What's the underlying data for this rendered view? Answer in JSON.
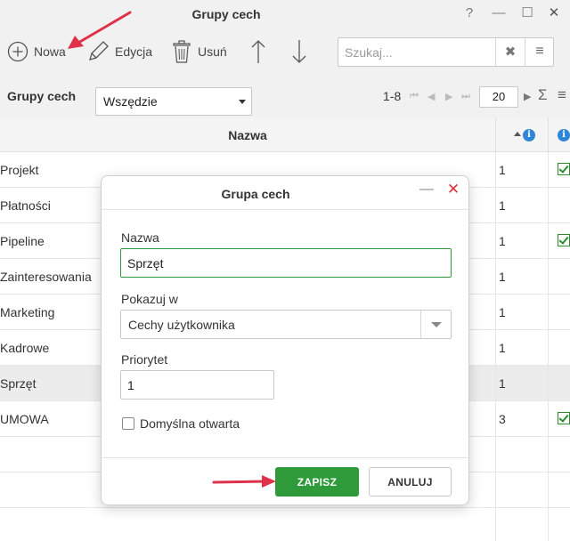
{
  "window": {
    "title": "Grupy cech",
    "help_glyph": "?",
    "minimize_glyph": "—",
    "maximize_glyph": "☐",
    "close_glyph": "✕"
  },
  "toolbar": {
    "new_label": "Nowa",
    "edit_label": "Edycja",
    "delete_label": "Usuń",
    "search_placeholder": "Szukaj...",
    "search_clear_glyph": "✖",
    "search_menu_glyph": "≡"
  },
  "filter": {
    "label": "Grupy cech",
    "select_value": "Wszędzie",
    "range": "1-8",
    "page_size": "20",
    "sum_glyph": "Σ",
    "menu_glyph": "≡"
  },
  "grid": {
    "header_name": "Nazwa",
    "info_glyph": "i",
    "rows": [
      {
        "name": "Projekt",
        "priority": "1",
        "default_open": true
      },
      {
        "name": "Płatności",
        "priority": "1",
        "default_open": false
      },
      {
        "name": "Pipeline",
        "priority": "1",
        "default_open": true
      },
      {
        "name": "Zainteresowania",
        "priority": "1",
        "default_open": false
      },
      {
        "name": "Marketing",
        "priority": "1",
        "default_open": false
      },
      {
        "name": "Kadrowe",
        "priority": "1",
        "default_open": false
      },
      {
        "name": "Sprzęt",
        "priority": "1",
        "default_open": false
      },
      {
        "name": "UMOWA",
        "priority": "3",
        "default_open": true
      }
    ],
    "selected_row": "Sprzęt"
  },
  "dialog": {
    "title": "Grupa cech",
    "min_glyph": "—",
    "close_glyph": "✕",
    "name_label": "Nazwa",
    "name_value": "Sprzęt",
    "show_in_label": "Pokazuj w",
    "show_in_value": "Cechy użytkownika",
    "priority_label": "Priorytet",
    "priority_value": "1",
    "default_open_label": "Domyślna otwarta",
    "default_open_checked": false,
    "save_label": "ZAPISZ",
    "cancel_label": "ANULUJ"
  },
  "colors": {
    "accent_green": "#2e9a3a",
    "annotation_red": "#e0314b",
    "info_blue": "#2f86d6"
  }
}
